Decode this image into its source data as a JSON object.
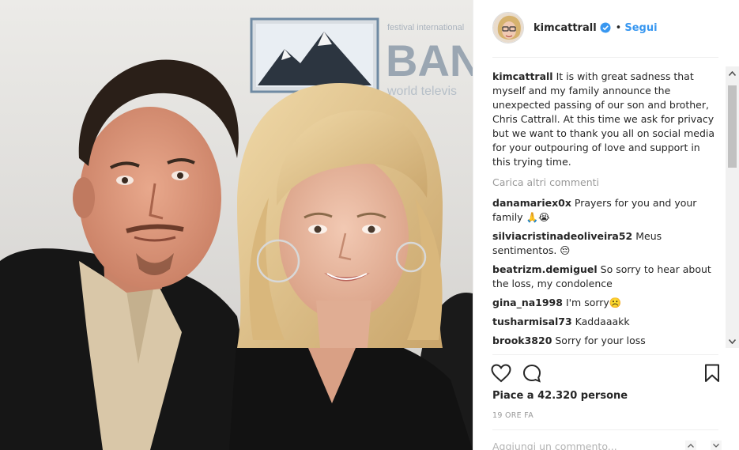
{
  "post": {
    "username": "kimcattrall",
    "follow_label": "Segui",
    "dot": "•",
    "photo_sign_text": "BAN",
    "photo_sign_sub": "world televis",
    "photo_sign_top": "festival international",
    "caption": "It is with great sadness that myself and my family announce the unexpected passing of our son and brother, Chris Cattrall. At this time we ask for privacy but we want to thank you all on social media for your outpouring of love and support in this trying time.",
    "load_more": "Carica altri commenti",
    "comments": [
      {
        "user": "danamariex0x",
        "text": "Prayers for you and your family 🙏😭"
      },
      {
        "user": "silviacristinadeoliveira52",
        "text": "Meus sentimentos. 😔"
      },
      {
        "user": "beatrizm.demiguel",
        "text": "So sorry to hear about the loss, my condolence"
      },
      {
        "user": "gina_na1998",
        "text": "I'm sorry☹️"
      },
      {
        "user": "tusharmisal73",
        "text": "Kaddaaakk"
      },
      {
        "user": "brook3820",
        "text": "Sorry for your loss"
      }
    ],
    "likes": "Piace a 42.320 persone",
    "timestamp": "19 ORE FA",
    "add_comment_placeholder": "Aggiungi un commento..."
  },
  "icons": {
    "verified": "verified-badge-icon",
    "like": "heart-icon",
    "comment": "comment-bubble-icon",
    "save": "bookmark-icon",
    "scroll_up": "chevron-up-icon",
    "scroll_down": "chevron-down-icon"
  },
  "colors": {
    "link_blue": "#3897f0",
    "text": "#262626",
    "muted": "#999999"
  }
}
